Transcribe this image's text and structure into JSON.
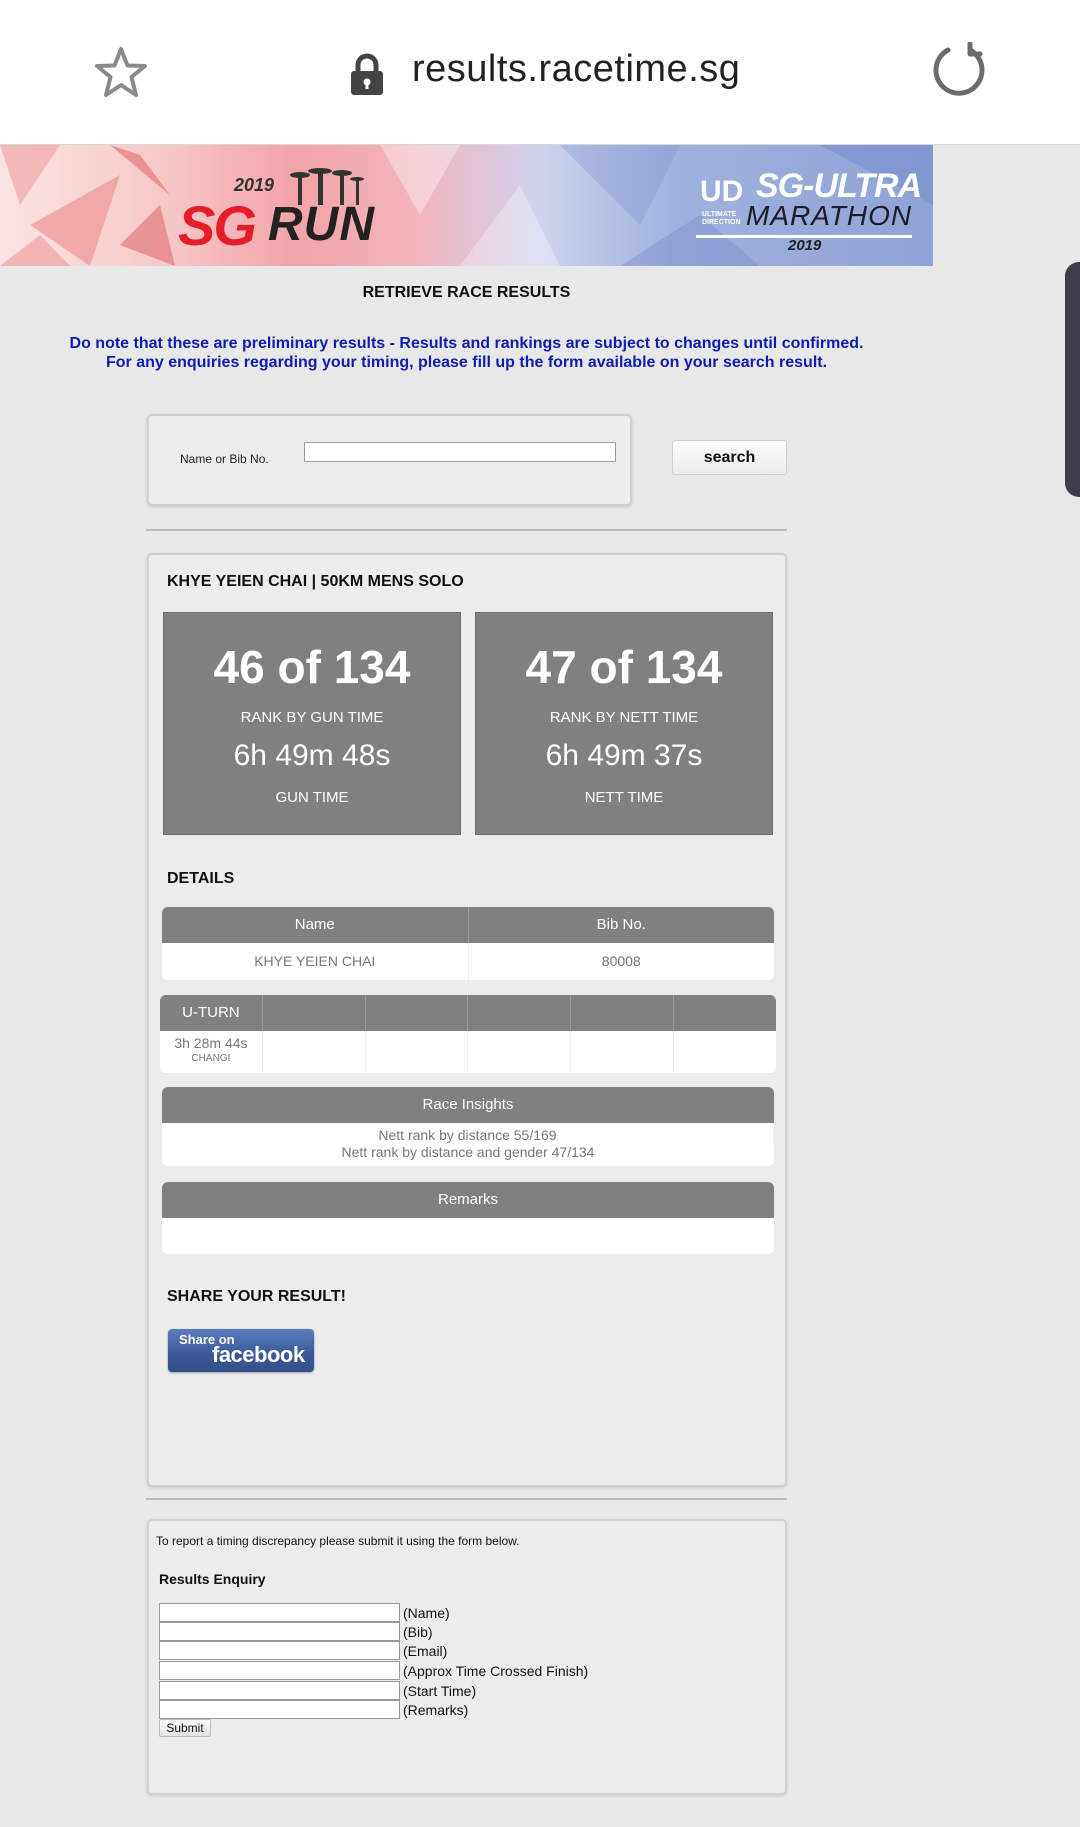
{
  "browser": {
    "url": "results.racetime.sg",
    "icons": {
      "bookmark": "star-icon",
      "secure": "lock-icon",
      "reload": "reload-icon"
    }
  },
  "banner": {
    "left_year": "2019",
    "left_brand_sg": "SG",
    "left_brand_run": "RUN",
    "right_logo": "UD",
    "right_logo_sub": "ULTIMATE DIRECTION",
    "right_title": "SG-ULTRA",
    "right_subtitle": "MARATHON",
    "right_year": "2019"
  },
  "page": {
    "heading": "RETRIEVE RACE RESULTS",
    "notice_line1": "Do note that these are preliminary results - Results and rankings are subject to changes until confirmed.",
    "notice_line2": "For any enquiries regarding your timing, please fill up the form available on your search result."
  },
  "search": {
    "label": "Name or Bib No.",
    "value": "",
    "button_label": "search"
  },
  "result": {
    "title": "KHYE YEIEN CHAI | 50KM MENS SOLO",
    "gun": {
      "rank": "46 of 134",
      "rank_label": "RANK BY GUN TIME",
      "time": "6h 49m 48s",
      "time_label": "GUN TIME"
    },
    "nett": {
      "rank": "47 of 134",
      "rank_label": "RANK BY NETT TIME",
      "time": "6h 49m 37s",
      "time_label": "NETT TIME"
    },
    "details_heading": "DETAILS",
    "details_table": {
      "headers": [
        "Name",
        "Bib No."
      ],
      "row": [
        "KHYE YEIEN CHAI",
        "80008"
      ]
    },
    "splits": {
      "headers": [
        "U-TURN",
        "",
        "",
        "",
        "",
        ""
      ],
      "first_time": "3h 28m 44s",
      "first_location": "CHANGI"
    },
    "insights": {
      "header": "Race Insights",
      "line1": "Nett rank by distance 55/169",
      "line2": "Nett rank by distance and gender 47/134"
    },
    "remarks": {
      "header": "Remarks",
      "text": ""
    },
    "share_heading": "SHARE YOUR RESULT!",
    "facebook": {
      "line1": "Share on",
      "line2": "facebook"
    }
  },
  "enquiry": {
    "intro": "To report a timing discrepancy please submit it using the form below.",
    "title": "Results Enquiry",
    "fields": [
      "(Name)",
      "(Bib)",
      "(Email)",
      "(Approx Time Crossed Finish)",
      "(Start Time)",
      "(Remarks)"
    ],
    "submit_label": "Submit"
  }
}
